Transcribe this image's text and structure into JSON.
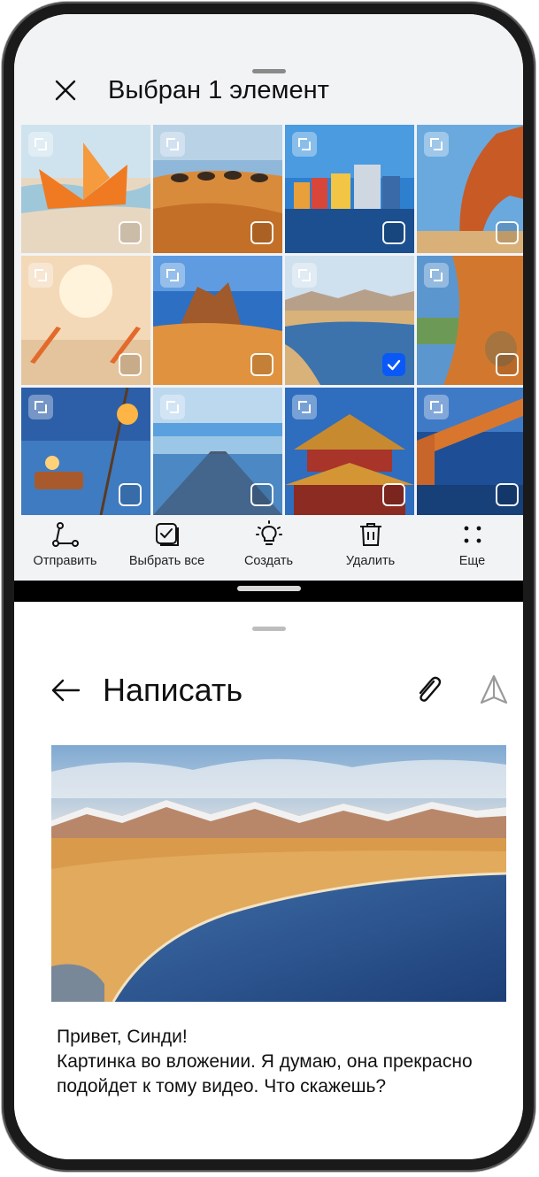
{
  "selection": {
    "title": "Выбран 1 элемент",
    "close_icon": "close-icon"
  },
  "gallery": {
    "thumbs": [
      {
        "name": "paper-boat",
        "selected": false
      },
      {
        "name": "desert-camels",
        "selected": false
      },
      {
        "name": "colorful-houses",
        "selected": false
      },
      {
        "name": "rock-arch",
        "selected": false
      },
      {
        "name": "beach-chairs",
        "selected": false
      },
      {
        "name": "desert-rocks",
        "selected": false
      },
      {
        "name": "lake-mountains",
        "selected": true
      },
      {
        "name": "tent-teddy",
        "selected": false
      },
      {
        "name": "lantern-sunset",
        "selected": false
      },
      {
        "name": "salt-road",
        "selected": false
      },
      {
        "name": "pagoda",
        "selected": false
      },
      {
        "name": "bridge",
        "selected": false
      }
    ]
  },
  "toolbar": {
    "share": "Отправить",
    "select_all": "Выбрать все",
    "create": "Создать",
    "delete": "Удалить",
    "more": "Еще"
  },
  "compose": {
    "title": "Написать",
    "greeting": "Привет, Синди!",
    "body": "Картинка во вложении. Я думаю, она прекрасно подойдет к тому видео. Что скажешь?"
  },
  "colors": {
    "accent": "#0a59f7",
    "panel_bg": "#f1f3f5"
  }
}
